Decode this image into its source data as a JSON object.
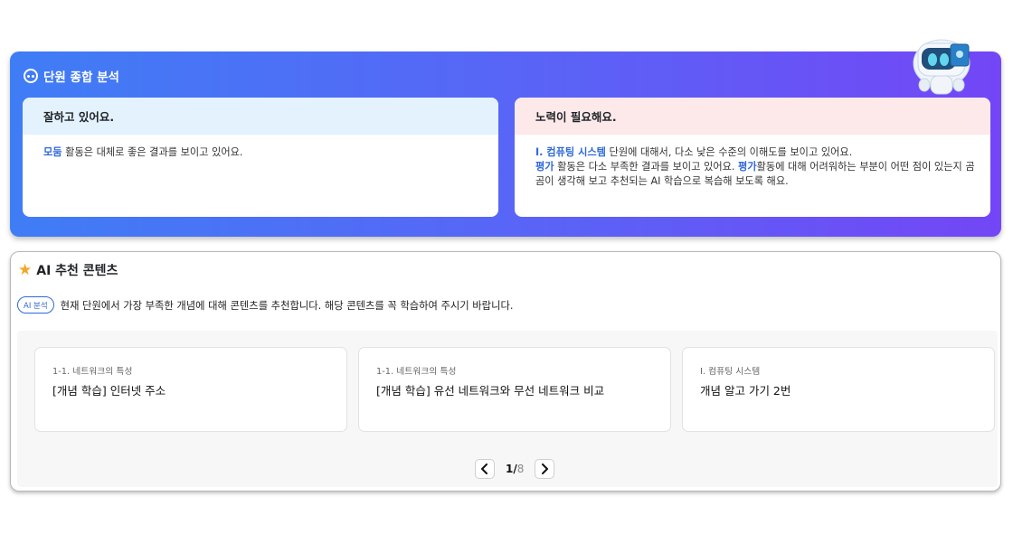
{
  "analysis": {
    "title": "단원 종합 분석",
    "good": {
      "header": "잘하고 있어요.",
      "line1_hl": "모둠",
      "line1_rest": " 활동은 대체로 좋은 결과를 보이고 있어요."
    },
    "need": {
      "header": "노력이 필요해요.",
      "line1_hl": "I. 컴퓨팅 시스템",
      "line1_rest": " 단원에 대해서, 다소 낮은 수준의 이해도를 보이고 있어요.",
      "line2_hl1": "평가",
      "line2_mid": " 활동은 다소 부족한 결과를 보이고 있어요. ",
      "line2_hl2": "평가",
      "line2_rest": "활동에 대해 어려워하는 부분이 어떤 점이 있는지 곰곰이 생각해 보고 추천되는 AI 학습으로 복습해 보도록 해요."
    }
  },
  "recommend": {
    "title": "AI 추천 콘텐츠",
    "badge": "AI 분석",
    "description": "현재 단원에서 가장 부족한 개념에 대해 콘텐츠를 추천합니다. 해당 콘텐츠를 꼭 학습하여 주시기 바랍니다.",
    "items": [
      {
        "unit": "1-1. 네트워크의 특성",
        "name": "[개념 학습] 인터넷 주소"
      },
      {
        "unit": "1-1. 네트워크의 특성",
        "name": "[개념 학습] 유선 네트워크와 무선 네트워크 비교"
      },
      {
        "unit": "I. 컴퓨팅 시스템",
        "name": "개념 알고 가기 2번"
      }
    ],
    "pager": {
      "current": "1",
      "separator": "/",
      "total": "8"
    }
  },
  "colors": {
    "gradient_start": "#3f7df5",
    "gradient_end": "#7346f6",
    "highlight": "#2f69d9",
    "good_header_bg": "#e3f2fd",
    "need_header_bg": "#fde9ea",
    "star": "#f5a623"
  },
  "icons": {
    "analysis": "analysis-eyes-icon",
    "robot": "robot-mascot",
    "star": "star-icon",
    "prev": "chevron-left-icon",
    "next": "chevron-right-icon"
  }
}
